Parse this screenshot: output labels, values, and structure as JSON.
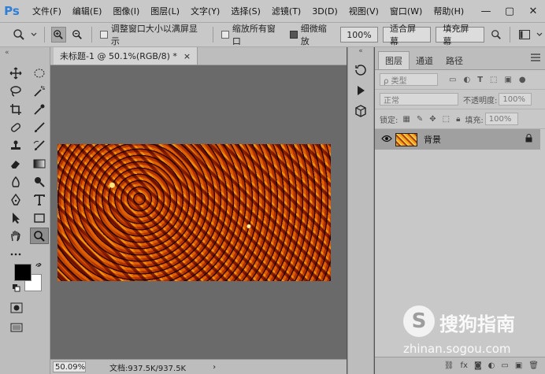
{
  "app": {
    "logo": "Ps"
  },
  "menu": [
    "文件(F)",
    "编辑(E)",
    "图像(I)",
    "图层(L)",
    "文字(Y)",
    "选择(S)",
    "滤镜(T)",
    "3D(D)",
    "视图(V)",
    "窗口(W)",
    "帮助(H)"
  ],
  "window_controls": [
    "—",
    "▢",
    "✕"
  ],
  "options": {
    "resize_windows_label": "调整窗口大小以满屏显示",
    "zoom_all_label": "缩放所有窗口",
    "scrubby_label": "细微缩放",
    "zoom_value": "100%",
    "fit_screen": "适合屏幕",
    "fill_screen": "填充屏幕"
  },
  "document": {
    "tab_title": "未标题-1 @ 50.1%(RGB/8) *",
    "tab_close": "×",
    "status_zoom": "50.09%",
    "status_doc": "文档:937.5K/937.5K"
  },
  "layers_panel": {
    "tabs": [
      "图层",
      "通道",
      "路径"
    ],
    "filter_kind": "ρ 类型",
    "blend_mode": "正常",
    "opacity_label": "不透明度:",
    "opacity_value": "100%",
    "lock_label": "锁定:",
    "fill_label": "填充:",
    "fill_value": "100%",
    "layer_name": "背景",
    "bottom_icons": [
      "fx"
    ]
  },
  "watermark": {
    "cn": "搜狗指南",
    "url": "zhinan.sogou.com"
  },
  "colors": {
    "accent": "#2f7fd6",
    "panel": "#c8c8c8",
    "canvas_bg": "#6a6a6a"
  }
}
